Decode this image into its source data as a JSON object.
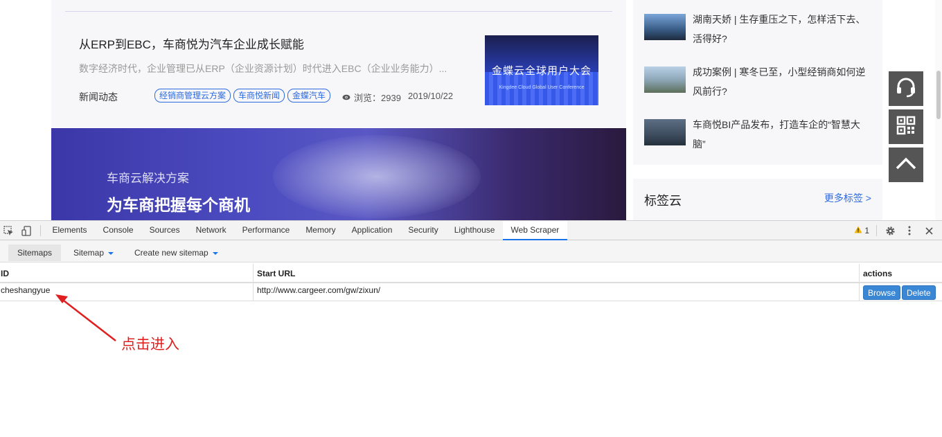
{
  "site": {
    "article": {
      "title": "从ERP到EBC，车商悦为汽车企业成长赋能",
      "desc": "数字经济时代，企业管理已从ERP（企业资源计划）时代进入EBC（企业业务能力）...",
      "category": "新闻动态",
      "tags": [
        "经销商管理云方案",
        "车商悦新闻",
        "金蝶汽车"
      ],
      "views": "浏览：2939",
      "date": "2019/10/22",
      "thumb_text": "金蝶云全球用户大会",
      "thumb_sub": "Kingdee Cloud Global User Conference"
    },
    "banner": {
      "subtitle": "车商云解决方案",
      "headline": "为车商把握每个商机"
    },
    "side_articles": [
      "湖南天娇 | 生存重压之下，怎样活下去、活得好?",
      "成功案例 | 寒冬已至，小型经销商如何逆风前行?",
      "车商悦BI产品发布，打造车企的“智慧大脑”"
    ],
    "tag_cloud": {
      "title": "标签云",
      "more": "更多标签 >"
    }
  },
  "devtools": {
    "tabs": [
      "Elements",
      "Console",
      "Sources",
      "Network",
      "Performance",
      "Memory",
      "Application",
      "Security",
      "Lighthouse",
      "Web Scraper"
    ],
    "active_tab": "Web Scraper",
    "warning_count": "1",
    "scraper_nav": {
      "sitemaps": "Sitemaps",
      "sitemap": "Sitemap",
      "create": "Create new sitemap"
    },
    "table": {
      "headers": {
        "id": "ID",
        "start_url": "Start URL",
        "actions": "actions"
      },
      "rows": [
        {
          "id": "cheshangyue",
          "start_url": "http://www.cargeer.com/gw/zixun/",
          "browse": "Browse",
          "delete": "Delete"
        }
      ]
    }
  },
  "annotation": {
    "text": "点击进入",
    "color": "#e02020"
  }
}
